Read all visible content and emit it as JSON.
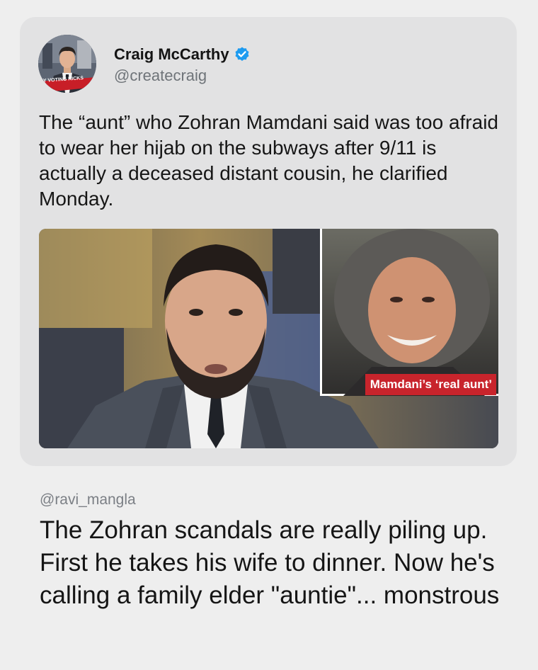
{
  "tweet": {
    "author_name": "Craig McCarthy",
    "author_handle": "@createcraig",
    "verified": true,
    "verified_color": "#1d9bf0",
    "avatar_banner_text": "Y VOTING KICKS",
    "text": "The “aunt” who Zohran Mamdani said was too afraid to wear her hijab on the subways after 9/11 is actually a deceased distant cousin, he clarified Monday.",
    "media": {
      "inset_caption": "Mamdani’s ‘real aunt’",
      "caption_color": "#c8242c"
    }
  },
  "reply": {
    "handle": "@ravi_mangla",
    "text": "The Zohran scandals are really piling up. First he takes his wife to dinner. Now he's calling a family elder \"auntie\"... monstrous"
  },
  "colors": {
    "page_background": "#eeeeee",
    "card_background": "#e2e2e3"
  }
}
